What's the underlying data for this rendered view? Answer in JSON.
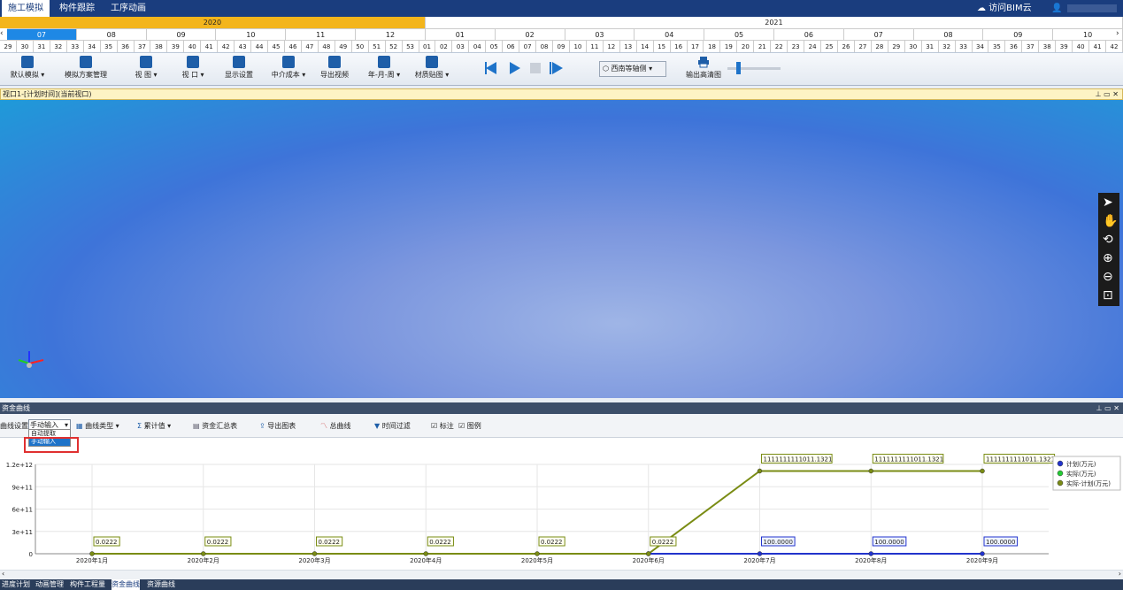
{
  "app": {
    "tabs": [
      "施工模拟",
      "构件跟踪",
      "工序动画"
    ],
    "active_tab": 0,
    "cloud_link": "访问BIM云",
    "user_icon": "user-icon"
  },
  "timeline": {
    "years": [
      "2020",
      "2021"
    ],
    "months": [
      "07",
      "08",
      "09",
      "10",
      "11",
      "12",
      "01",
      "02",
      "03",
      "04",
      "05",
      "06",
      "07",
      "08",
      "09",
      "10"
    ],
    "weeks": [
      "29",
      "30",
      "31",
      "32",
      "33",
      "34",
      "35",
      "36",
      "37",
      "38",
      "39",
      "40",
      "41",
      "42",
      "43",
      "44",
      "45",
      "46",
      "47",
      "48",
      "49",
      "50",
      "51",
      "52",
      "53",
      "01",
      "02",
      "03",
      "04",
      "05",
      "06",
      "07",
      "08",
      "09",
      "10",
      "11",
      "12",
      "13",
      "14",
      "15",
      "16",
      "17",
      "18",
      "19",
      "20",
      "21",
      "22",
      "23",
      "24",
      "25",
      "26",
      "27",
      "28",
      "29",
      "30",
      "31",
      "32",
      "33",
      "34",
      "35",
      "36",
      "37",
      "38",
      "39",
      "40",
      "41",
      "42"
    ],
    "year_2020_color": "#f3b51c"
  },
  "toolbar": {
    "buttons": [
      {
        "label": "默认模拟",
        "icon": "copy-icon"
      },
      {
        "label": "模拟方案管理",
        "icon": "document-settings-icon"
      },
      {
        "label": "视 图",
        "icon": "monitor-icon"
      },
      {
        "label": "视 口",
        "icon": "monitor-icon"
      },
      {
        "label": "显示设置",
        "icon": "toggle-icon"
      },
      {
        "label": "中介成本",
        "icon": "sigma-icon"
      },
      {
        "label": "导出视频",
        "icon": "film-icon"
      },
      {
        "label": "年-月-周",
        "icon": "calendar-icon"
      },
      {
        "label": "材质贴图",
        "icon": "texture-icon"
      }
    ],
    "view_dropdown": "西南等轴侧",
    "export_image": "输出高清图"
  },
  "viewport": {
    "title": "视口1-[计划时间](当前视口)"
  },
  "panel": {
    "title": "资金曲线",
    "curve_setting_label": "曲线设置",
    "curve_mode": "手动输入",
    "curve_options": [
      "自动提取",
      "手动输入"
    ],
    "buttons": {
      "curve_type": "曲线类型",
      "cumulative": "累计值",
      "summary": "资金汇总表",
      "export_table": "导出图表",
      "total_curve": "总曲线",
      "time_filter": "时间过滤"
    },
    "checkboxes": {
      "annotation": "标注",
      "legend": "图例"
    }
  },
  "chart_data": {
    "type": "line",
    "categories": [
      "2020年1月",
      "2020年2月",
      "2020年3月",
      "2020年4月",
      "2020年5月",
      "2020年6月",
      "2020年7月",
      "2020年8月",
      "2020年9月"
    ],
    "yticks": [
      "1.2e+12",
      "9e+11",
      "6e+11",
      "3e+11",
      "0"
    ],
    "ylim": [
      0,
      1200000000000.0
    ],
    "series": [
      {
        "name": "计划(万元)",
        "color": "#2233cc",
        "values": [
          null,
          null,
          null,
          null,
          null,
          0,
          100,
          100,
          100
        ],
        "labels": [
          "",
          "",
          "",
          "",
          "",
          "",
          "100.0000",
          "100.0000",
          "100.0000"
        ]
      },
      {
        "name": "实际(万元)",
        "color": "#22cc33",
        "values": [
          0.0222,
          0.0222,
          0.0222,
          0.0222,
          0.0222,
          0.0222,
          1111111111011.132,
          1111111111011.132,
          1111111111011.132
        ],
        "labels": []
      },
      {
        "name": "实际-计划(万元)",
        "color": "#7a8c14",
        "values": [
          0.0222,
          0.0222,
          0.0222,
          0.0222,
          0.0222,
          0.0222,
          1111111111011.132,
          1111111111011.132,
          1111111111011.132
        ],
        "labels": [
          "0.0222",
          "0.0222",
          "0.0222",
          "0.0222",
          "0.0222",
          "0.0222",
          "1111111111011.1321",
          "1111111111011.1321",
          "1111111111011.1321"
        ]
      }
    ]
  },
  "statusbar": {
    "tabs": [
      "进度计划",
      "动画管理",
      "构件工程量",
      "资金曲线",
      "资源曲线"
    ],
    "active": 3
  }
}
